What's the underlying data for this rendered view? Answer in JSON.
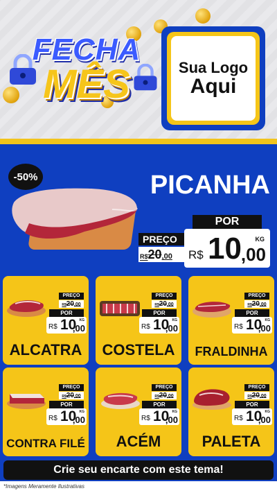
{
  "header": {
    "title_line1": "FECHA",
    "title_line2": "MÊS",
    "logo_line1": "Sua Logo",
    "logo_line2": "Aqui"
  },
  "hero": {
    "discount_badge": "-50%",
    "product_name": "PICANHA",
    "preco_label": "PREÇO",
    "old_currency": "R$",
    "old_price": "20",
    "old_cents": ",00",
    "por_label": "POR",
    "currency": "R$",
    "price": "10",
    "cents": ",00",
    "unit": "KG"
  },
  "products": [
    {
      "name": "ALCATRA",
      "preco_label": "PREÇO",
      "old_currency": "R$",
      "old_price": "20",
      "old_cents": ",00",
      "por_label": "POR",
      "currency": "R$",
      "price": "10",
      "cents": ",00",
      "unit": "KG"
    },
    {
      "name": "COSTELA",
      "preco_label": "PREÇO",
      "old_currency": "R$",
      "old_price": "20",
      "old_cents": ",00",
      "por_label": "POR",
      "currency": "R$",
      "price": "10",
      "cents": ",00",
      "unit": "KG"
    },
    {
      "name": "FRALDINHA",
      "preco_label": "PREÇO",
      "old_currency": "R$",
      "old_price": "20",
      "old_cents": ",00",
      "por_label": "POR",
      "currency": "R$",
      "price": "10",
      "cents": ",00",
      "unit": "KG"
    },
    {
      "name": "CONTRA FILÉ",
      "preco_label": "PREÇO",
      "old_currency": "R$",
      "old_price": "20",
      "old_cents": ",00",
      "por_label": "POR",
      "currency": "R$",
      "price": "10",
      "cents": ",00",
      "unit": "KG"
    },
    {
      "name": "ACÉM",
      "preco_label": "PREÇO",
      "old_currency": "R$",
      "old_price": "20",
      "old_cents": ",00",
      "por_label": "POR",
      "currency": "R$",
      "price": "10",
      "cents": ",00",
      "unit": "KG"
    },
    {
      "name": "PALETA",
      "preco_label": "PREÇO",
      "old_currency": "R$",
      "old_price": "20",
      "old_cents": ",00",
      "por_label": "POR",
      "currency": "R$",
      "price": "10",
      "cents": ",00",
      "unit": "KG"
    }
  ],
  "cta": {
    "label": "Crie seu encarte com este tema!"
  },
  "footer": {
    "disclaimer": "*Imagens Meramente Ilustrativas"
  },
  "colors": {
    "blue": "#0f3fc0",
    "yellow": "#f5c518",
    "black": "#111111",
    "meat": "#b3263a"
  }
}
